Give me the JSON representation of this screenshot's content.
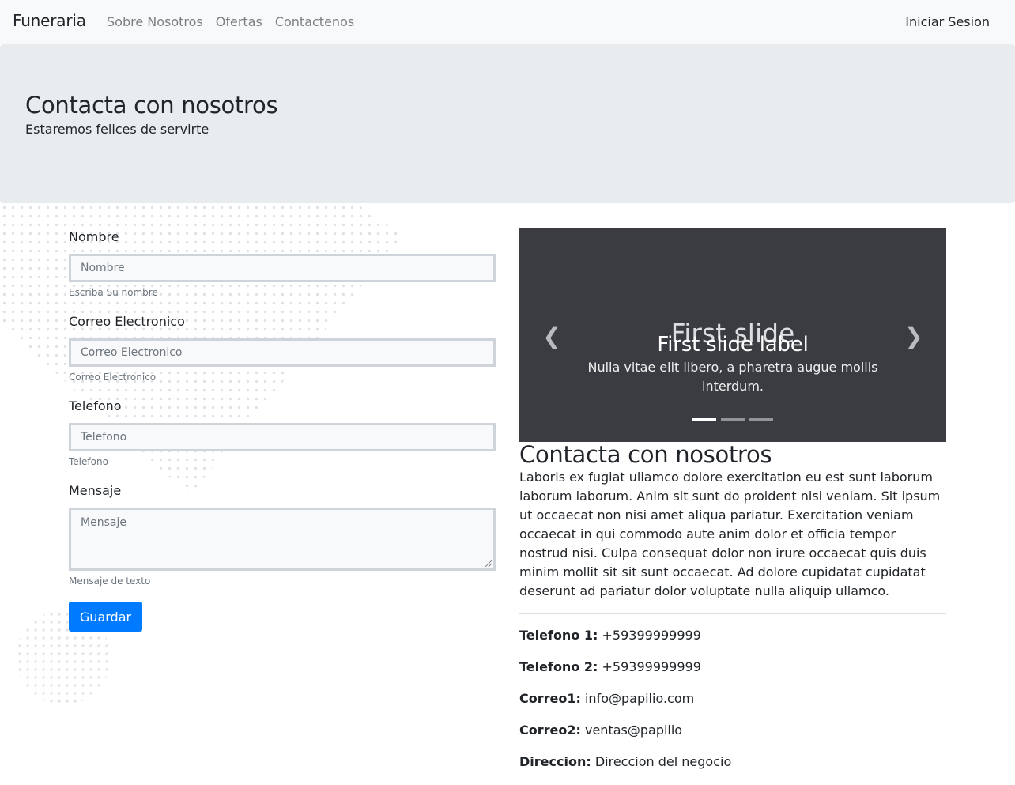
{
  "navbar": {
    "brand": "Funeraria",
    "links": [
      "Sobre Nosotros",
      "Ofertas",
      "Contactenos"
    ],
    "login": "Iniciar Sesion"
  },
  "jumbotron": {
    "title": "Contacta con nosotros",
    "subtitle": "Estaremos felices de servirte"
  },
  "form": {
    "fields": [
      {
        "label": "Nombre",
        "placeholder": "Nombre",
        "help": "Escriba Su nombre"
      },
      {
        "label": "Correo Electronico",
        "placeholder": "Correo Electronico",
        "help": "Correo Electronico"
      },
      {
        "label": "Telefono",
        "placeholder": "Telefono",
        "help": "Telefono"
      },
      {
        "label": "Mensaje",
        "placeholder": "Mensaje",
        "help": "Mensaje de texto"
      }
    ],
    "submit": "Guardar"
  },
  "carousel": {
    "slide_text": "First slide",
    "caption_title": "First slide label",
    "caption_text": "Nulla vitae elit libero, a pharetra augue mollis interdum.",
    "prev_icon": "chevron-left-icon",
    "next_icon": "chevron-right-icon",
    "indicator_count": 3,
    "active_index": 0
  },
  "contact": {
    "title": "Contacta con nosotros",
    "body": "Laboris ex fugiat ullamco dolore exercitation eu est sunt laborum laborum laborum. Anim sit sunt do proident nisi veniam. Sit ipsum ut occaecat non nisi amet aliqua pariatur. Exercitation veniam occaecat in qui commodo aute anim dolor et officia tempor nostrud nisi. Culpa consequat dolor non irure occaecat quis duis minim mollit sit sit sunt occaecat. Ad dolore cupidatat cupidatat deserunt ad pariatur dolor voluptate nulla aliquip ullamco.",
    "items": [
      {
        "label": "Telefono 1:",
        "value": "+59399999999"
      },
      {
        "label": "Telefono 2:",
        "value": "+59399999999"
      },
      {
        "label": "Correo1:",
        "value": "info@papilio.com"
      },
      {
        "label": "Correo2:",
        "value": "ventas@papilio"
      },
      {
        "label": "Direccion:",
        "value": "Direccion del negocio"
      }
    ]
  },
  "colors": {
    "primary": "#007bff",
    "navbar_bg": "#f8f9fa",
    "jumbotron_bg": "#e9ecef",
    "carousel_bg": "#3a3c41"
  }
}
